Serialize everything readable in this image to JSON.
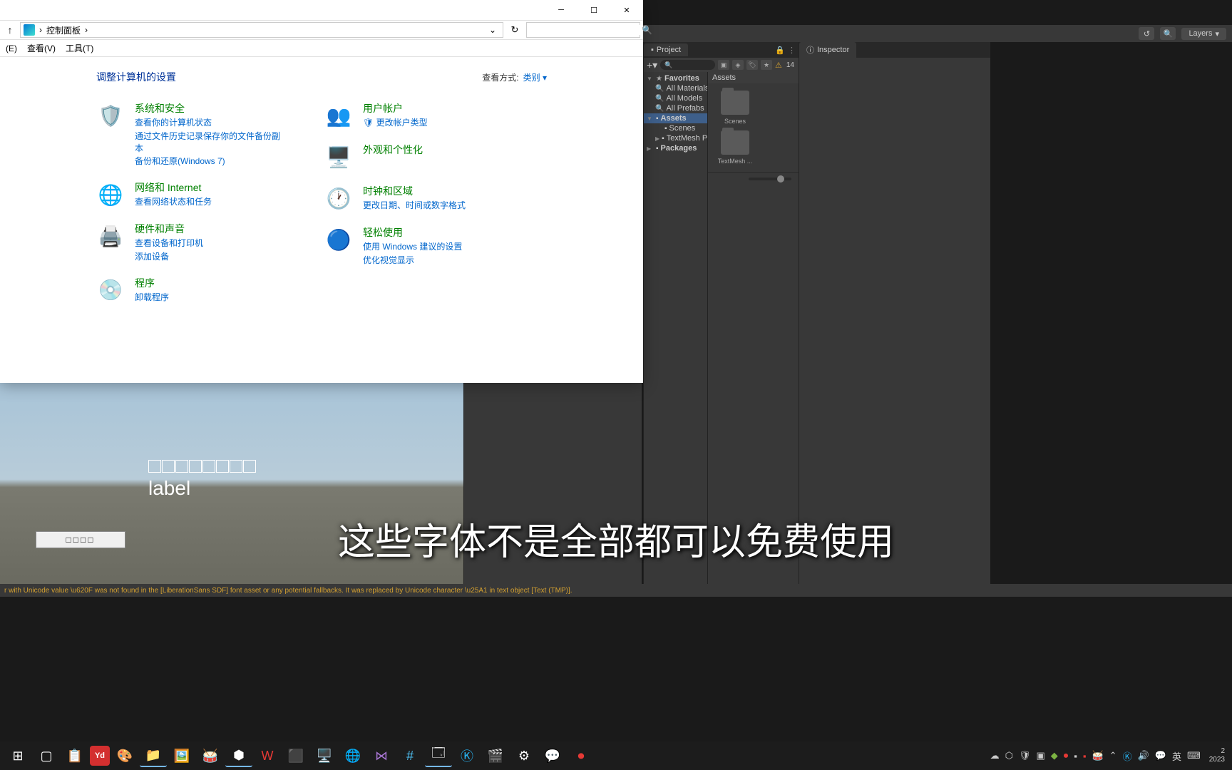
{
  "cp": {
    "path": "控制面板",
    "menus": [
      "(E)",
      "查看(V)",
      "工具(T)"
    ],
    "title": "调整计算机的设置",
    "viewby_label": "查看方式:",
    "viewby_value": "类别",
    "cats_left": [
      {
        "icon": "🛡️",
        "cls": "ic-shield",
        "title": "系统和安全",
        "links": [
          "查看你的计算机状态",
          "通过文件历史记录保存你的文件备份副本",
          "备份和还原(Windows 7)"
        ]
      },
      {
        "icon": "🌐",
        "cls": "ic-net",
        "title": "网络和 Internet",
        "links": [
          "查看网络状态和任务"
        ]
      },
      {
        "icon": "🖨️",
        "cls": "ic-hw",
        "title": "硬件和声音",
        "links": [
          "查看设备和打印机",
          "添加设备"
        ]
      },
      {
        "icon": "💿",
        "cls": "ic-prog",
        "title": "程序",
        "links": [
          "卸载程序"
        ]
      }
    ],
    "cats_right": [
      {
        "icon": "👥",
        "cls": "ic-user",
        "title": "用户帐户",
        "links": [
          "🛡 更改帐户类型"
        ]
      },
      {
        "icon": "🖥️",
        "cls": "ic-appear",
        "title": "外观和个性化",
        "links": []
      },
      {
        "icon": "🕐",
        "cls": "ic-clock",
        "title": "时钟和区域",
        "links": [
          "更改日期、时间或数字格式"
        ]
      },
      {
        "icon": "🔵",
        "cls": "ic-ease",
        "title": "轻松使用",
        "links": [
          "使用 Windows 建议的设置",
          "优化视觉显示"
        ]
      }
    ]
  },
  "unity": {
    "toolbar": {
      "layers": "Layers"
    },
    "project_tab": "Project",
    "inspector_tab": "Inspector",
    "warn_count": "14",
    "tree": {
      "fav": "Favorites",
      "fav_items": [
        "All Materials",
        "All Models",
        "All Prefabs"
      ],
      "assets": "Assets",
      "assets_items": [
        "Scenes",
        "TextMesh P"
      ],
      "packages": "Packages"
    },
    "assets_header": "Assets",
    "folders": [
      "Scenes",
      "TextMesh ..."
    ]
  },
  "game": {
    "label": "label",
    "btn": "□□□□"
  },
  "subtitle": "这些字体不是全部都可以免费使用",
  "console_msg": "r with Unicode value \\u620F was not found in the [LiberationSans SDF] font asset or any potential fallbacks. It was replaced by Unicode character \\u25A1 in text object [Text (TMP)].",
  "tray": {
    "ime": "英",
    "year": "2023"
  }
}
